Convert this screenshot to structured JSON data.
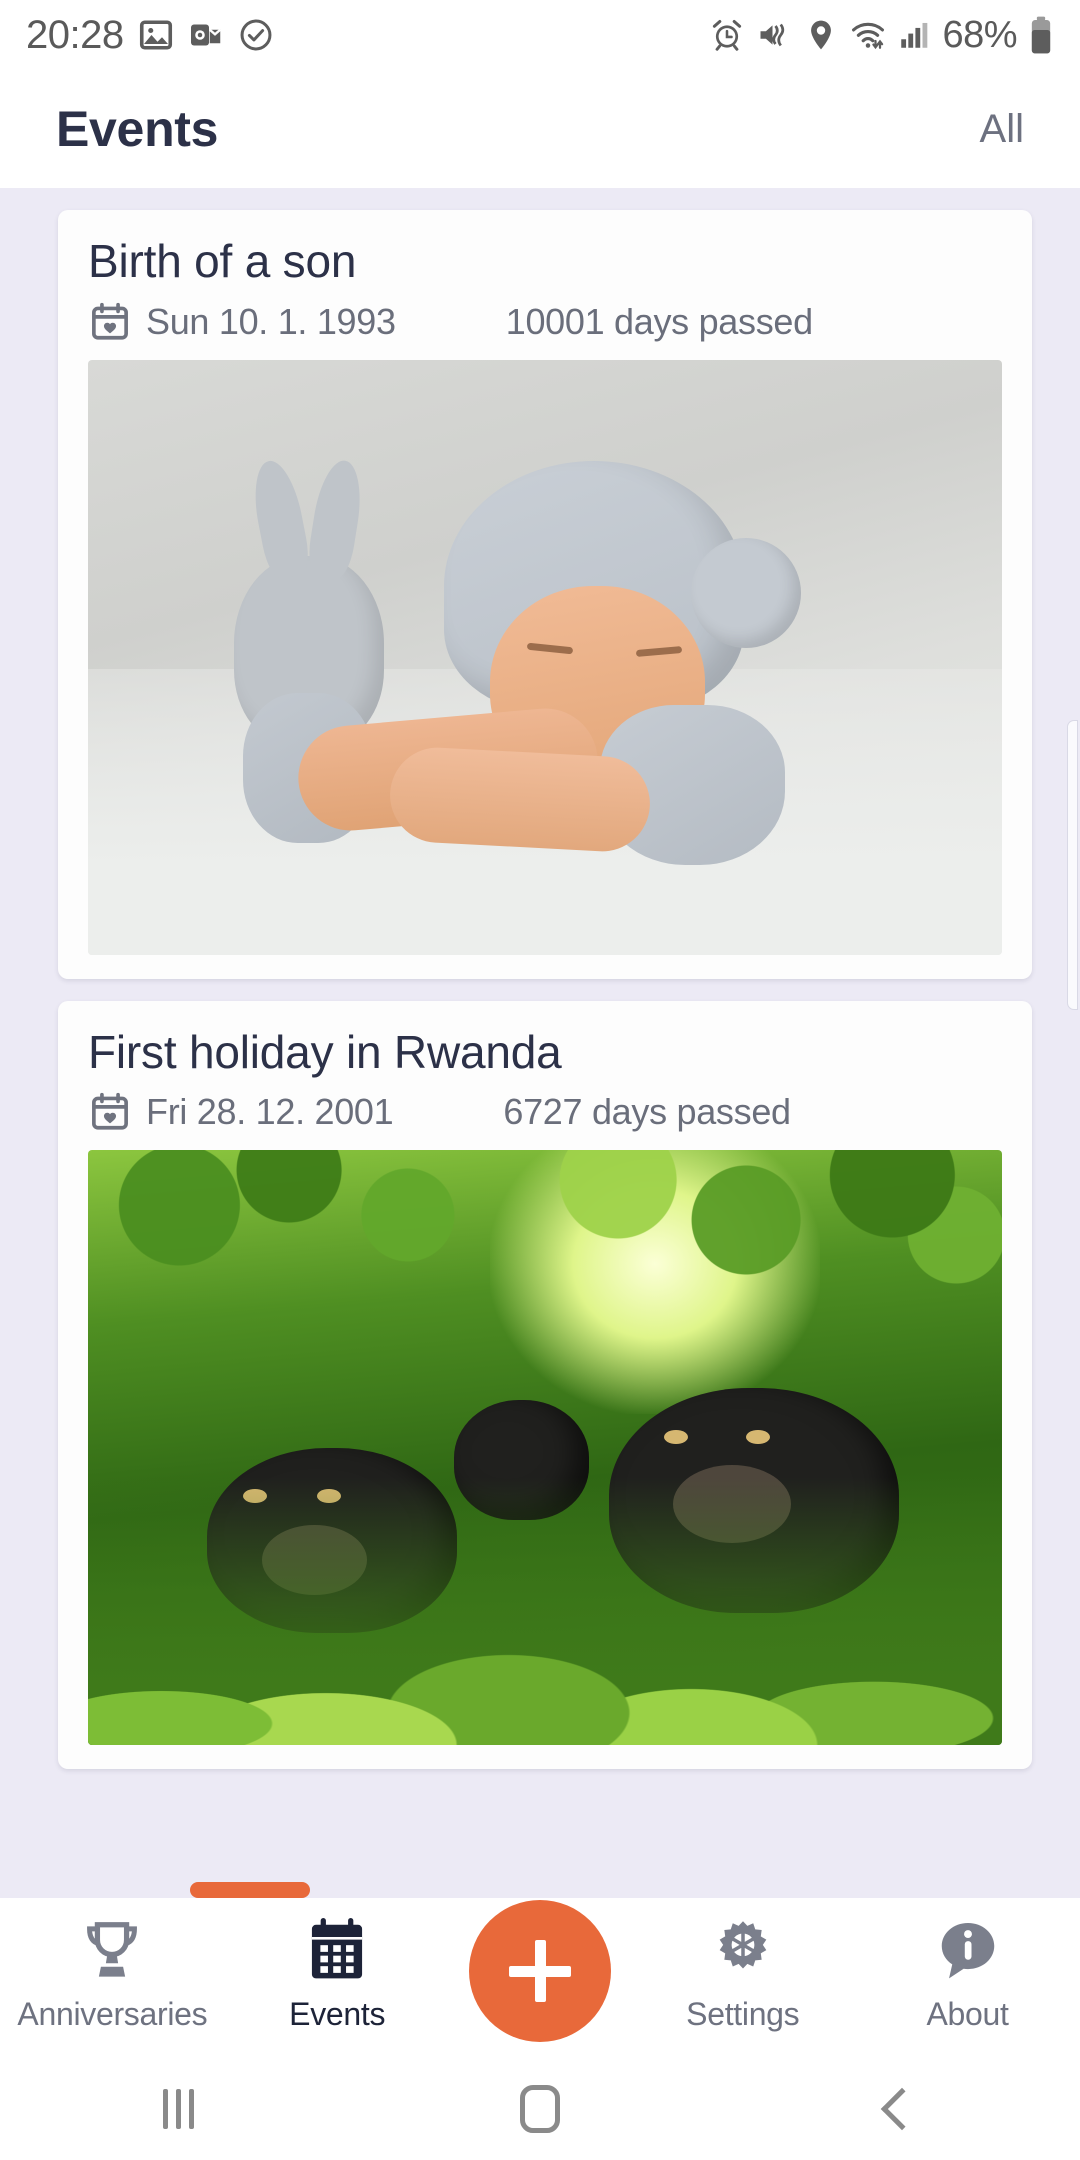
{
  "status_bar": {
    "time": "20:28",
    "battery_percent": "68%",
    "left_icons": [
      "photos-icon",
      "outlook-icon",
      "check-circle-icon"
    ],
    "right_icons": [
      "alarm-icon",
      "mute-vibrate-icon",
      "location-pin-icon",
      "wifi-icon",
      "signal-bars-icon",
      "battery-icon"
    ]
  },
  "app_bar": {
    "title": "Events",
    "filter_label": "All"
  },
  "events": [
    {
      "title": "Birth of a son",
      "date": "Sun 10. 1. 1993",
      "days_passed": "10001 days passed",
      "date_icon": "calendar-heart-icon",
      "photo": "newborn-baby-in-grey-knit-hat-photo"
    },
    {
      "title": "First holiday in Rwanda",
      "date": "Fri 28. 12. 2001",
      "days_passed": "6727 days passed",
      "date_icon": "calendar-heart-icon",
      "photo": "mountain-gorillas-in-jungle-photo"
    }
  ],
  "bottom_nav": {
    "items": [
      {
        "label": "Anniversaries",
        "icon": "trophy-icon",
        "active": false
      },
      {
        "label": "Events",
        "icon": "calendar-icon",
        "active": true
      },
      {
        "label": "",
        "icon": "plus-icon",
        "active": false
      },
      {
        "label": "Settings",
        "icon": "gear-icon",
        "active": false
      },
      {
        "label": "About",
        "icon": "info-bubble-icon",
        "active": false
      }
    ]
  },
  "system_nav": {
    "recents": "recents-icon",
    "home": "home-icon",
    "back": "back-icon"
  },
  "colors": {
    "accent": "#e8693a",
    "title_text": "#2c3148",
    "muted_text": "#6a6e7b",
    "page_background": "#eceaf5",
    "card_background": "#fdfdfd"
  }
}
